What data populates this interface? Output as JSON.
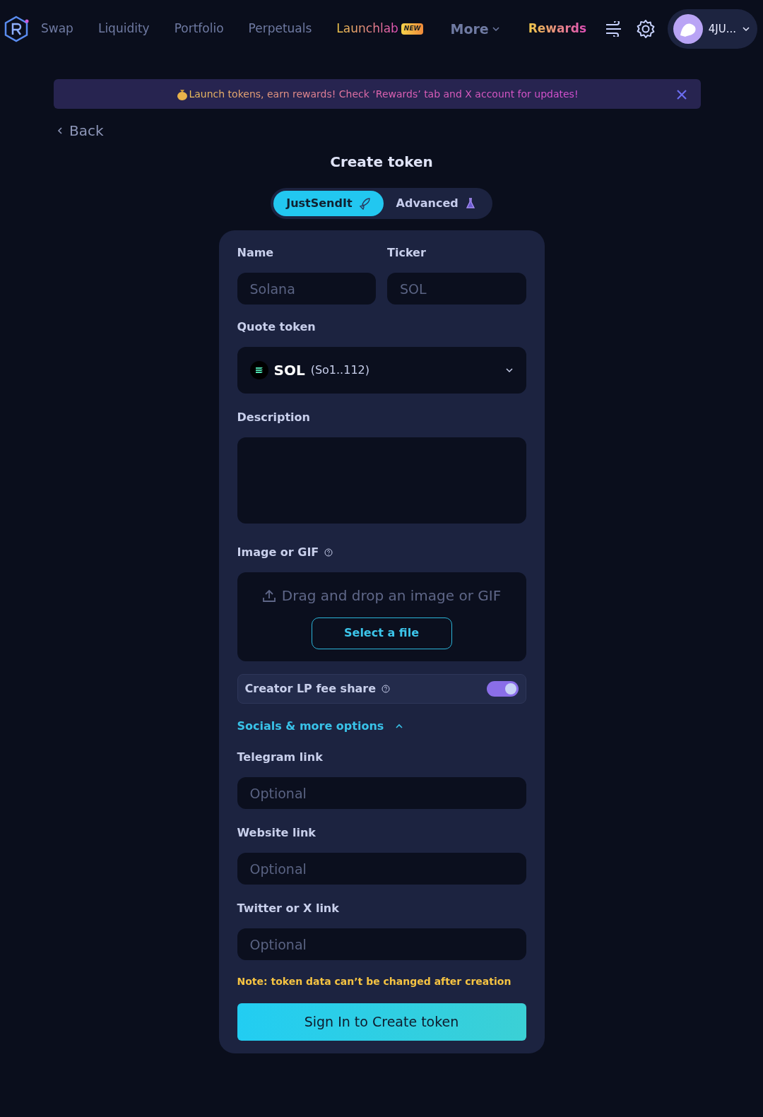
{
  "nav": {
    "links": [
      {
        "label": "Swap",
        "kind": "plain"
      },
      {
        "label": "Liquidity",
        "kind": "plain"
      },
      {
        "label": "Portfolio",
        "kind": "plain"
      },
      {
        "label": "Perpetuals",
        "kind": "plain"
      },
      {
        "label": "Launchlab",
        "kind": "new",
        "badge": "NEW"
      },
      {
        "label": "More",
        "kind": "dropdown"
      },
      {
        "label": "Rewards",
        "kind": "rewards"
      }
    ],
    "account": "4JU..."
  },
  "banner": {
    "text": "Launch tokens, earn rewards! Check ‘Rewards’ tab and X account for updates!"
  },
  "back": "Back",
  "title": "Create token",
  "modes": [
    {
      "label": "JustSendIt",
      "selected": true
    },
    {
      "label": "Advanced",
      "selected": false
    }
  ],
  "form": {
    "name": {
      "label": "Name",
      "placeholder": "Solana"
    },
    "ticker": {
      "label": "Ticker",
      "placeholder": "SOL"
    },
    "quote_token": {
      "label": "Quote token",
      "symbol": "SOL",
      "address": "(So1..112)"
    },
    "description": {
      "label": "Description"
    },
    "image": {
      "label": "Image or GIF",
      "drop_text": "Drag and drop an image or GIF",
      "button": "Select a file"
    },
    "fee_share": {
      "label": "Creator LP fee share",
      "on": true
    },
    "socials": {
      "label": "Socials & more options",
      "expanded": true,
      "fields": [
        {
          "label": "Telegram link",
          "placeholder": "Optional"
        },
        {
          "label": "Website link",
          "placeholder": "Optional"
        },
        {
          "label": "Twitter or X link",
          "placeholder": "Optional"
        }
      ]
    },
    "note": "Note: token data can’t be changed after creation",
    "submit": "Sign In to Create token"
  }
}
